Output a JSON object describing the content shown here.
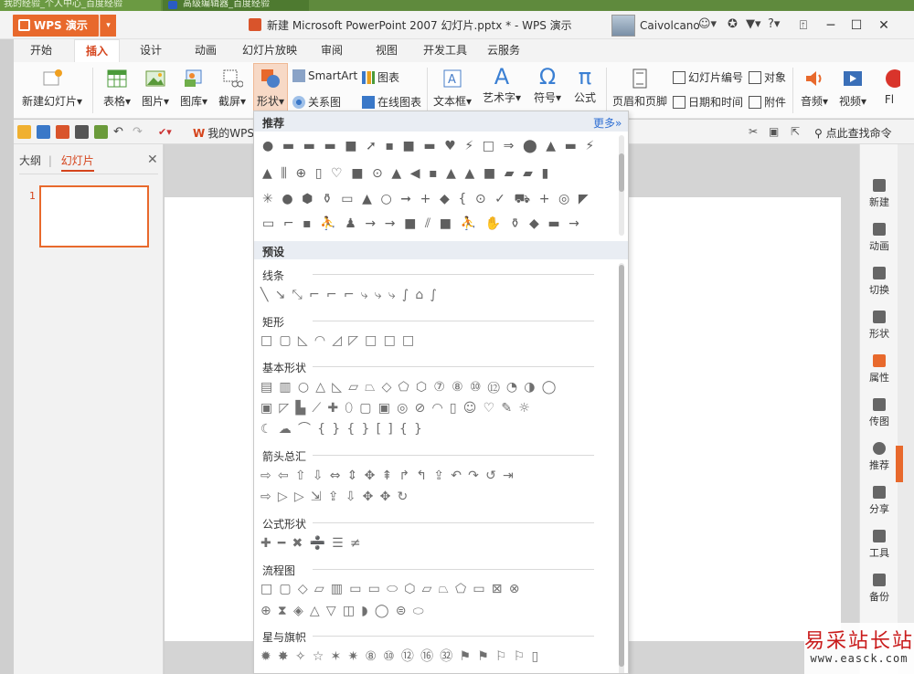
{
  "browser_tabs": [
    "我的经验_个人中心_百度经验",
    "高级编辑器_百度经验"
  ],
  "titlebar": {
    "app_name": "WPS 演示",
    "dropdown": "▾",
    "doc_title": "新建 Microsoft PowerPoint 2007 幻灯片.pptx * - WPS 演示",
    "username": "Caivolcano",
    "icons": [
      "skin-icon",
      "shirt-icon",
      "help-icon"
    ],
    "help_label": "?",
    "window_controls": [
      "minimize",
      "maximize",
      "close"
    ]
  },
  "menu_tabs": [
    "开始",
    "插入",
    "设计",
    "动画",
    "幻灯片放映",
    "审阅",
    "视图",
    "开发工具",
    "云服务"
  ],
  "active_tab": "插入",
  "ribbon": {
    "new_slide": "新建幻灯片",
    "table": "表格",
    "image": "图片",
    "gallery": "图库",
    "screenshot": "截屏",
    "shape": "形状",
    "smartart": "SmartArt",
    "chart": "图表",
    "relation": "关系图",
    "online_chart": "在线图表",
    "textbox": "文本框",
    "wordart": "艺术字",
    "symbol": "符号",
    "formula": "公式",
    "header_footer": "页眉和页脚",
    "slide_number": "幻灯片编号",
    "object": "对象",
    "datetime": "日期和时间",
    "attachment": "附件",
    "audio": "音频",
    "video": "视频",
    "flash": "Fl",
    "dropdown_marker": "▾",
    "symbol_glyph": "Ω",
    "formula_glyph": "π",
    "wordart_glyph": "A"
  },
  "quickbar": {
    "my_wps": "我的WPS",
    "find_command": "点此查找命令"
  },
  "left_panel": {
    "tab_outline": "大纲",
    "tab_slides": "幻灯片",
    "separator": "|",
    "close": "✕",
    "slide_number": "1"
  },
  "right_sidebar": [
    "新建",
    "动画",
    "切换",
    "形状",
    "属性",
    "传图",
    "推荐",
    "分享",
    "工具",
    "备份"
  ],
  "shapes_menu": {
    "recommended_title": "推荐",
    "more_link": "更多»",
    "recommended_rows": [
      "●▬▬▬■➚▪■▬♥⚡□⇒⬤▲▬⚡",
      "▲⫼⊕▯♡■⊙▲◀▪▲▲■▰▰▮",
      "✳●⬢⚱▭▲○➞+◆{⊙✓⛟+◎◤",
      "▭⌐▪⛹♟→→■⫽■⛹✋⚱◆▬→"
    ],
    "preset_title": "预设",
    "categories": [
      {
        "name": "线条",
        "rows": [
          "╲↘⤡⌐⌐⌐⤷⤷⤷∫⌂∫"
        ]
      },
      {
        "name": "矩形",
        "rows": [
          "□▢◺◠◿◸□□□"
        ]
      },
      {
        "name": "基本形状",
        "rows": [
          "▤▥○△◺▱⏢◇⬠⬡⑦⑧⑩⑫◔◑◯",
          "▣◸▙⟋✚⬯▢▣◎⊘◠▯☺♡✎☼",
          "☾☁⌒{}{}[]{}"
        ]
      },
      {
        "name": "箭头总汇",
        "rows": [
          "⇨⇦⇧⇩⇔⇕✥⇞↱↰⇪↶↷↺⇥",
          "⇨▷▷⇲⇪⇩✥✥↻"
        ]
      },
      {
        "name": "公式形状",
        "rows": [
          "✚━✖➗☰≠"
        ]
      },
      {
        "name": "流程图",
        "rows": [
          "□▢◇▱▥▭▭⬭⬡▱⏢⬠▭⊠⊗",
          "⊕⧗◈△▽◫◗◯⊜⬭"
        ]
      },
      {
        "name": "星与旗帜",
        "rows": [
          "✹✸✧☆✶✷⑧⑩⑫⑯㉜⚑⚑⚐⚐▯"
        ]
      }
    ]
  },
  "watermark": {
    "cn": "易采站长站",
    "url": "www.easck.com"
  },
  "colors": {
    "accent": "#e8692c",
    "active_tab_text": "#d5441c",
    "link_blue": "#2f6fd3"
  }
}
